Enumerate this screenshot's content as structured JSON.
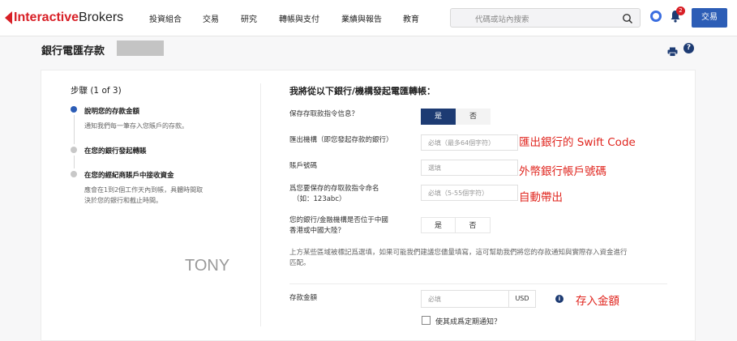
{
  "brand": {
    "name_red": "Interactive",
    "name_dark": "Brokers"
  },
  "nav": [
    {
      "label": "投資組合"
    },
    {
      "label": "交易"
    },
    {
      "label": "研究"
    },
    {
      "label": "轉帳與支付"
    },
    {
      "label": "業績與報告"
    },
    {
      "label": "教育"
    }
  ],
  "search": {
    "placeholder": "代碼或站內搜索"
  },
  "notifications": {
    "count": "2"
  },
  "trade_button": "交易",
  "page": {
    "title": "銀行電匯存款"
  },
  "steps": {
    "title": "步驟 (1 of 3)",
    "items": [
      {
        "label": "說明您的存款金額",
        "desc_line1": "通知我們每一筆存入您賬戶的存款。",
        "desc_line2": ""
      },
      {
        "label": "在您的銀行發起轉賬",
        "desc_line1": "",
        "desc_line2": ""
      },
      {
        "label": "在您的經紀商賬戶中接收資金",
        "desc_line1": "應會在1到2個工作天內到帳，具體時間取",
        "desc_line2": "決於您的銀行和截止時間。"
      }
    ],
    "accent_color": "#2c5db6"
  },
  "watermark": "TONY",
  "form": {
    "title": "我將從以下銀行/機構發起電匯轉帳：",
    "save_label": "保存存取款指令信息？",
    "save_yes": "是",
    "save_no": "否",
    "bank_label": "匯出機構（即您發起存款的銀行）",
    "bank_placeholder": "必填（最多64個字符）",
    "account_label": "賬戶號碼",
    "account_placeholder": "選填",
    "name_label_line1": "爲您要保存的存取款指令命名",
    "name_label_line2": "（如：123abc）",
    "name_placeholder": "必填（5-55個字符）",
    "china_label_line1": "您的銀行/金融機構是否位于中國",
    "china_label_line2": "香港或中國大陸？",
    "china_yes": "是",
    "china_no": "否",
    "note_line1": "上方某些區域被標記爲選填，如果可能我們建議您儘量填寫，這可幫助我們將您的存款通知與實際存入資金進行",
    "note_line2": "匹配。",
    "amount_label": "存款金額",
    "amount_placeholder": "必填",
    "currency": "USD",
    "recurring_label": "使其成爲定期通知？"
  },
  "annotations": {
    "swift": "匯出銀行的 Swift Code",
    "account": "外幣銀行帳戶號碼",
    "auto": "自動帶出",
    "amount": "存入金額"
  },
  "icons": {
    "search": "search-icon",
    "help": "help-circle-icon",
    "bell": "bell-icon",
    "print": "printer-icon",
    "info": "info-icon"
  }
}
